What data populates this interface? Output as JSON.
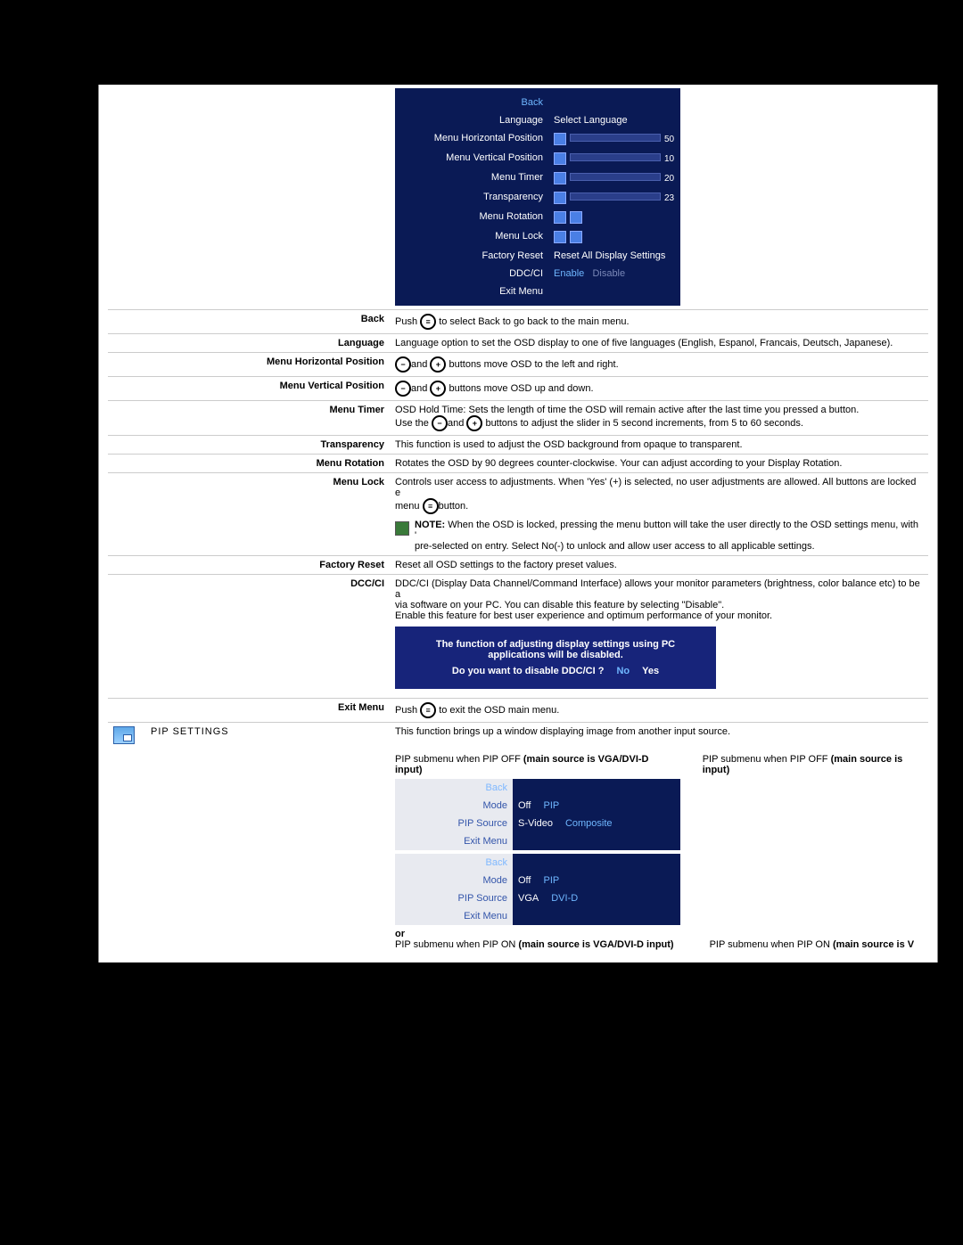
{
  "osd": {
    "back": "Back",
    "language": "Language",
    "language_val": "Select Language",
    "hpos": "Menu Horizontal Position",
    "hpos_val": "50",
    "vpos": "Menu Vertical Position",
    "vpos_val": "10",
    "timer": "Menu Timer",
    "timer_val": "20",
    "transparency": "Transparency",
    "transparency_val": "23",
    "rotation": "Menu Rotation",
    "lock": "Menu Lock",
    "factory": "Factory Reset",
    "factory_val": "Reset All Display Settings",
    "ddcci": "DDC/CI",
    "ddcci_enable": "Enable",
    "ddcci_disable": "Disable",
    "exit": "Exit Menu"
  },
  "rows": {
    "back": {
      "label": "Back",
      "text_a": "Push ",
      "text_b": " to select Back to go back to the main menu."
    },
    "language": {
      "label": "Language",
      "text": "Language option to set the OSD display to one of five languages (English, Espanol, Francais, Deutsch, Japanese)."
    },
    "hpos": {
      "label": "Menu Horizontal Position",
      "t1": "and ",
      "t2": " buttons move OSD to the left and right."
    },
    "vpos": {
      "label": "Menu Vertical Position",
      "t1": "and ",
      "t2": " buttons move OSD up and down."
    },
    "timer": {
      "label": "Menu Timer",
      "l1": "OSD Hold Time: Sets the length of time the OSD will remain active after the last time you pressed a button.",
      "l2a": "Use the ",
      "l2b": "and ",
      "l2c": " buttons to adjust the slider in 5 second increments, from 5 to 60 seconds."
    },
    "transparency": {
      "label": "Transparency",
      "text": "This function is used to adjust the OSD background from opaque to transparent."
    },
    "rotation": {
      "label": "Menu Rotation",
      "text": "Rotates the OSD by 90 degrees counter-clockwise. Your can adjust according to your Display Rotation."
    },
    "lock": {
      "label": "Menu Lock",
      "l1a": "Controls user access to adjustments. When 'Yes' (+) is selected, no user adjustments are allowed. All buttons are locked e",
      "l1b": "menu ",
      "l1c": "button.",
      "note_bold": "NOTE:",
      "note": " When the OSD is locked, pressing the menu button will take the user directly to the OSD settings menu, with '\npre-selected on entry. Select No(-) to unlock and allow user access to all applicable settings."
    },
    "factory": {
      "label": "Factory Reset",
      "text": "Reset all OSD settings to the factory preset values."
    },
    "ddcci": {
      "label": "DCC/CI",
      "l1": "DDC/CI (Display Data Channel/Command Interface) allows your monitor parameters (brightness, color balance etc) to be a",
      "l2": "via software on your PC. You can disable this feature by selecting \"Disable\".",
      "l3": "Enable this feature for best user experience and optimum performance of your monitor."
    },
    "ddcidlg": {
      "l1": "The function of adjusting display settings using PC",
      "l2": "applications will be disabled.",
      "l3": "Do you want to disable DDC/CI ?",
      "no": "No",
      "yes": "Yes"
    },
    "exit": {
      "label": "Exit Menu",
      "t1": "Push ",
      "t2": " to exit the OSD main menu."
    }
  },
  "pip": {
    "section": "PIP SETTINGS",
    "intro": "This function brings up a window displaying image from another input source.",
    "cap1a": "PIP submenu when PIP OFF ",
    "cap1b": "(main source is VGA/DVI-D input)",
    "cap1c": "PIP submenu when PIP OFF ",
    "cap1d": "(main source is input)",
    "or": "or",
    "cap2a": "PIP submenu when PIP ON ",
    "cap2b": "(main source is VGA/DVI-D input)",
    "cap2c": "PIP submenu when PIP ON ",
    "cap2d": "(main source is V",
    "osd1": {
      "back": "Back",
      "mode": "Mode",
      "off": "Off",
      "pip": "PIP",
      "src": "PIP Source",
      "s1": "S-Video",
      "s2": "Composite",
      "exit": "Exit Menu"
    },
    "osd2": {
      "back": "Back",
      "mode": "Mode",
      "off": "Off",
      "pip": "PIP",
      "src": "PIP Source",
      "s1": "VGA",
      "s2": "DVI-D",
      "exit": "Exit Menu"
    }
  },
  "icons": {
    "minus": "−",
    "plus": "+",
    "menu": "≡"
  }
}
